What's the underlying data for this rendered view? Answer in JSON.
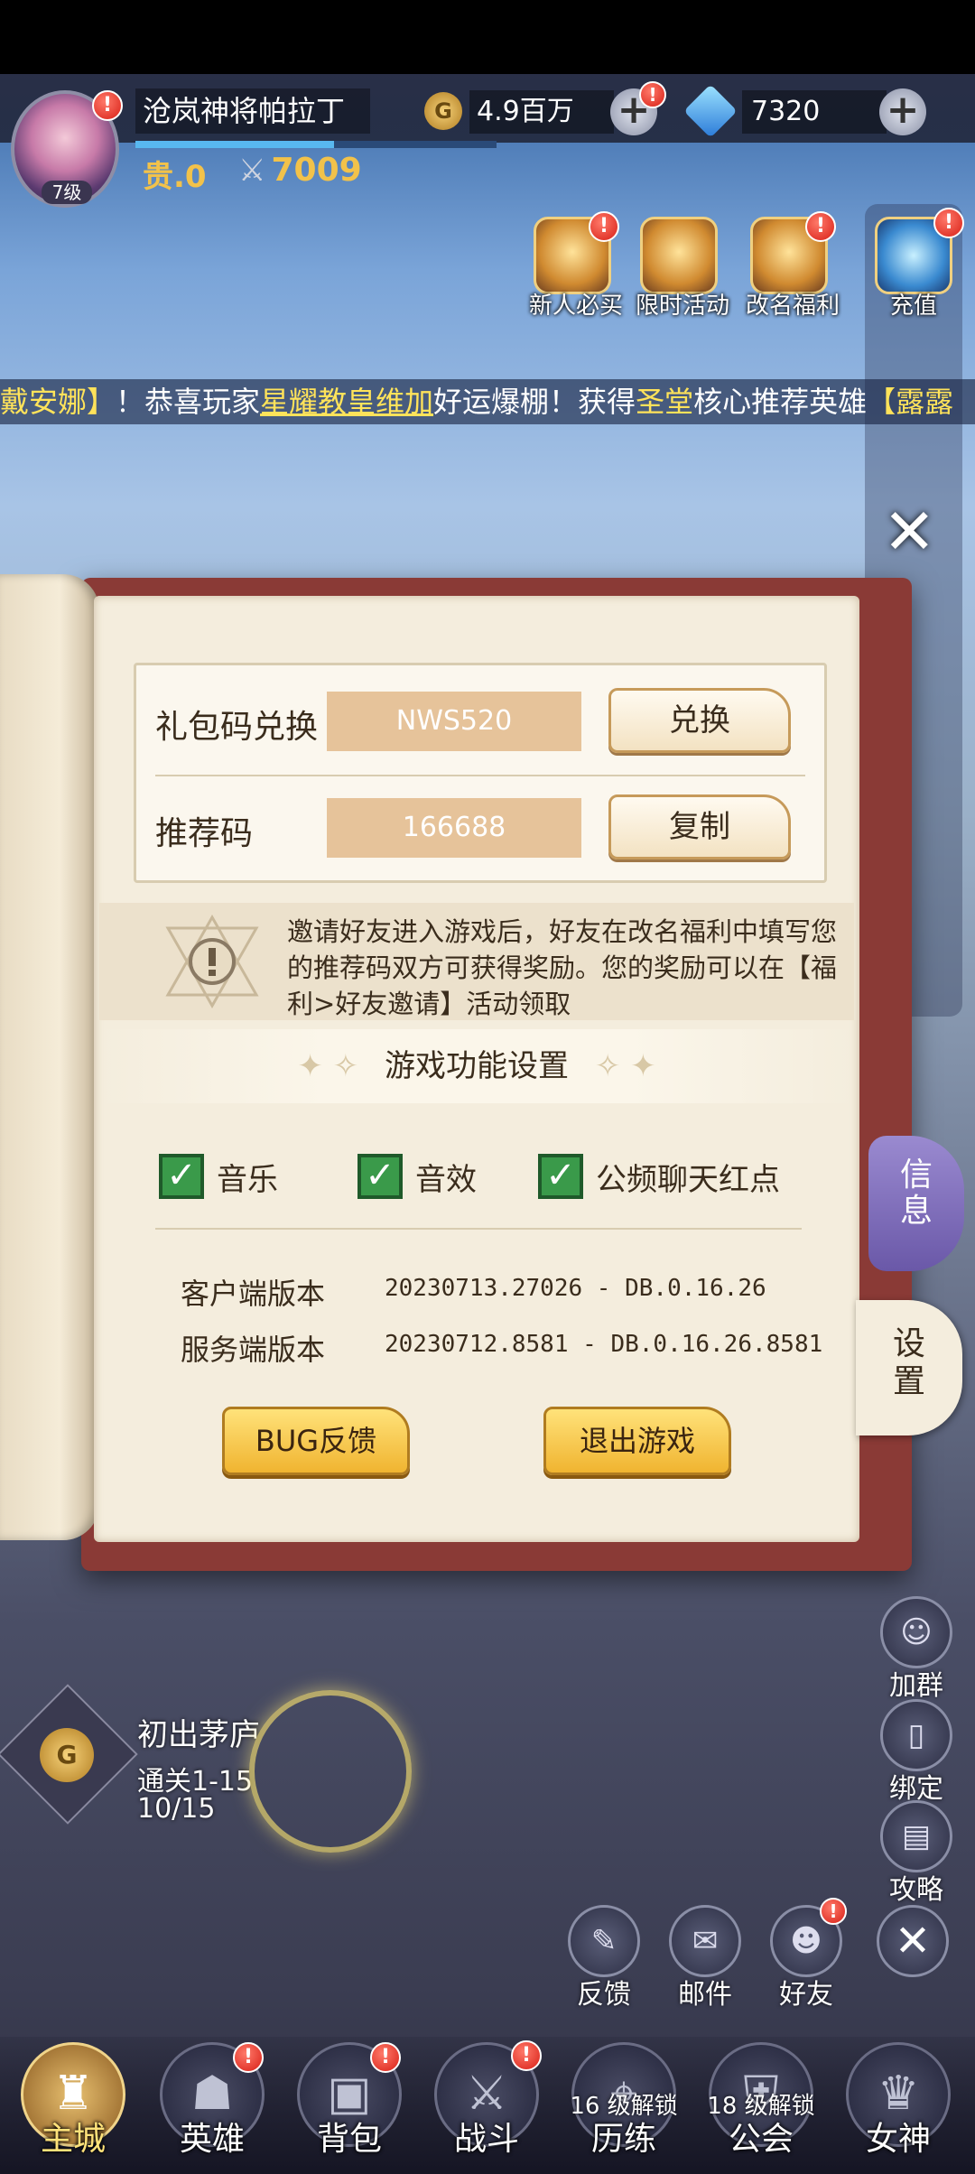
{
  "player": {
    "name": "沧岚神将帕拉丁",
    "level": "7级",
    "vip": "贵.0",
    "power": "7009"
  },
  "currency": {
    "gold_icon": "G",
    "gold": "4.9百万",
    "gems": "7320"
  },
  "activities": [
    {
      "label": "新人必买",
      "icon": "cannon-icon"
    },
    {
      "label": "限时活动",
      "icon": "clock-icon"
    },
    {
      "label": "改名福利",
      "icon": "gift-box-icon"
    },
    {
      "label": "充值",
      "icon": "diamond-icon"
    }
  ],
  "ticker": {
    "part1": "戴安娜】",
    "part2": "！恭喜玩家",
    "player": "星耀教皇维加",
    "part3": "好运爆棚！获得",
    "faction": "圣堂",
    "part4": "核心推荐英雄",
    "hero": "【露露"
  },
  "panel": {
    "close": "✕",
    "gift_code": {
      "label": "礼包码兑换",
      "value": "NWS520",
      "button": "兑换"
    },
    "referral": {
      "label": "推荐码",
      "value": "166688",
      "button": "复制"
    },
    "invite_text": "邀请好友进入游戏后，好友在改名福利中填写您的推荐码双方可获得奖励。您的奖励可以在【福利>好友邀请】活动领取",
    "settings_title": "游戏功能设置",
    "options": [
      {
        "label": "音乐",
        "checked": true
      },
      {
        "label": "音效",
        "checked": true
      },
      {
        "label": "公频聊天红点",
        "checked": true
      }
    ],
    "client_version_label": "客户端版本",
    "client_version": "20230713.27026 - DB.0.16.26",
    "server_version_label": "服务端版本",
    "server_version": "20230712.8581 - DB.0.16.26.8581",
    "bug_button": "BUG反馈",
    "exit_button": "退出游戏"
  },
  "tabs": {
    "info": "信息",
    "settings": "设置"
  },
  "side_buttons": [
    {
      "label": "加群",
      "icon": "chat-group-icon"
    },
    {
      "label": "绑定",
      "icon": "phone-icon"
    },
    {
      "label": "攻略",
      "icon": "book-icon"
    }
  ],
  "utility": [
    {
      "label": "反馈",
      "icon": "feedback-icon"
    },
    {
      "label": "邮件",
      "icon": "mail-icon"
    },
    {
      "label": "好友",
      "icon": "friends-icon"
    }
  ],
  "quest": {
    "coin": "G",
    "title": "初出茅庐",
    "subtitle": "通关1-15",
    "progress": "10/15"
  },
  "nav": [
    {
      "label": "主城",
      "icon": "castle-icon",
      "active": true
    },
    {
      "label": "英雄",
      "icon": "hero-icon"
    },
    {
      "label": "背包",
      "icon": "backpack-icon"
    },
    {
      "label": "战斗",
      "icon": "swords-icon"
    },
    {
      "label": "历练",
      "icon": "map-pin-icon",
      "lock": "16 级解锁"
    },
    {
      "label": "公会",
      "icon": "guild-icon",
      "lock": "18 级解锁"
    },
    {
      "label": "女神",
      "icon": "goddess-icon"
    }
  ],
  "colors": {
    "accent_gold": "#f2c24a",
    "check_green": "#3a9a4a",
    "book_cover": "#8a3a36",
    "page": "#f4eddd"
  }
}
